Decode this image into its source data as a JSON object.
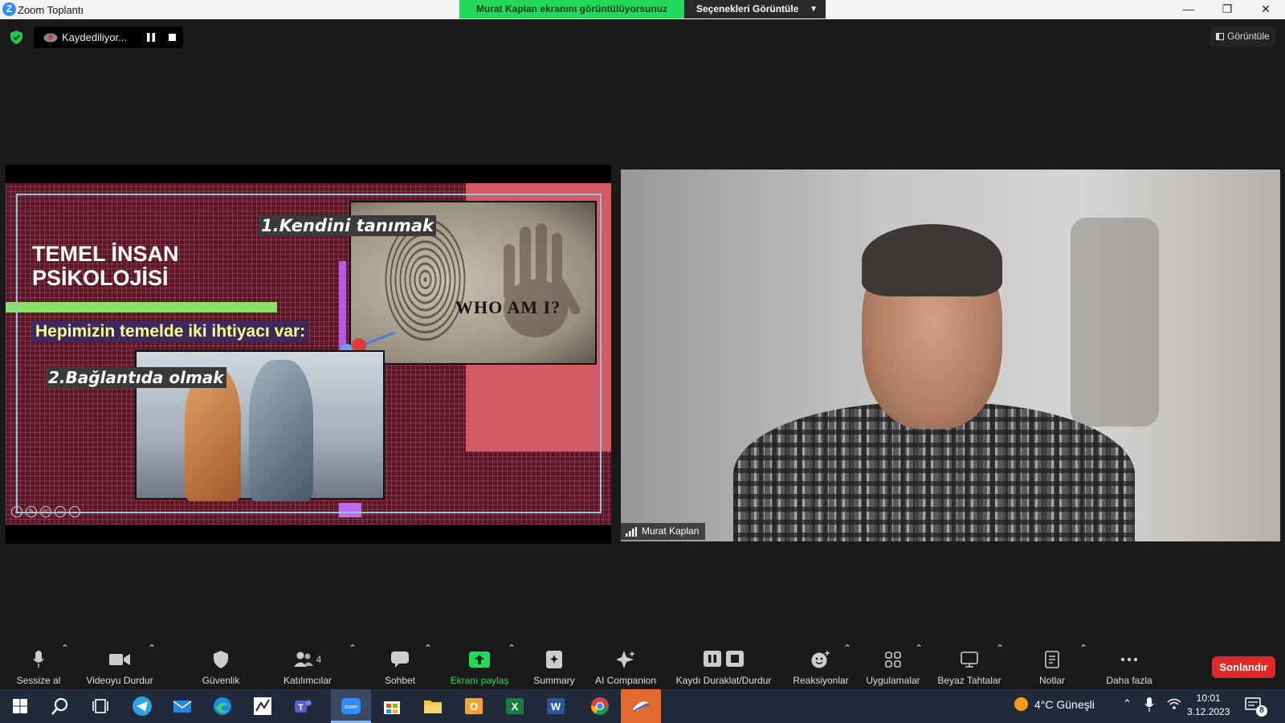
{
  "window": {
    "app_icon": "Z",
    "title": "Zoom Toplantı",
    "minimize_icon": "minimize-icon",
    "restore_icon": "restore-icon",
    "close_icon": "close-icon"
  },
  "share_banner": {
    "text": "Murat Kaplan ekranını görüntülüyorsunuz",
    "view_options_label": "Seçenekleri Görüntüle",
    "banner_color": "#23d959"
  },
  "recording": {
    "status_text": "Kaydediliyor...",
    "pause_icon": "pause-icon",
    "stop_icon": "stop-icon"
  },
  "view_button": {
    "label": "Görüntüle"
  },
  "slide": {
    "title": "TEMEL İNSAN PSİKOLOJİSİ",
    "subtitle": "Hepimizin temelde iki ihtiyacı var:",
    "item1": "1.Kendini tanımak",
    "item2": "2.Bağlantıda olmak",
    "image_text": "WHO  AM  I?",
    "accent_pink": "#d35a62",
    "accent_green": "#8ee06a",
    "accent_purple": "#b55be0"
  },
  "participant": {
    "name": "Murat Kaplan"
  },
  "toolbar": {
    "mute": "Sessize al",
    "video": "Videoyu Durdur",
    "security": "Güvenlik",
    "participants": "Katılımcılar",
    "participants_count": "4",
    "chat": "Sohbet",
    "share": "Ekranı paylaş",
    "summary": "Summary",
    "ai": "AI Companion",
    "record": "Kaydı Duraklat/Durdur",
    "reactions": "Reaksiyonlar",
    "apps": "Uygulamalar",
    "whiteboards": "Beyaz Tahtalar",
    "notes": "Notlar",
    "more": "Daha fazla",
    "end": "Sonlandır",
    "end_color": "#e02828"
  },
  "taskbar": {
    "weather": "4°C  Güneşli",
    "time": "10:01",
    "date": "3.12.2023",
    "notification_count": "8",
    "apps": [
      "windows-start",
      "search",
      "task-view",
      "telegram",
      "mail",
      "edge",
      "paint",
      "teams",
      "zoom",
      "store",
      "file-explorer",
      "outlook",
      "excel",
      "word",
      "chrome",
      "other-app"
    ]
  }
}
